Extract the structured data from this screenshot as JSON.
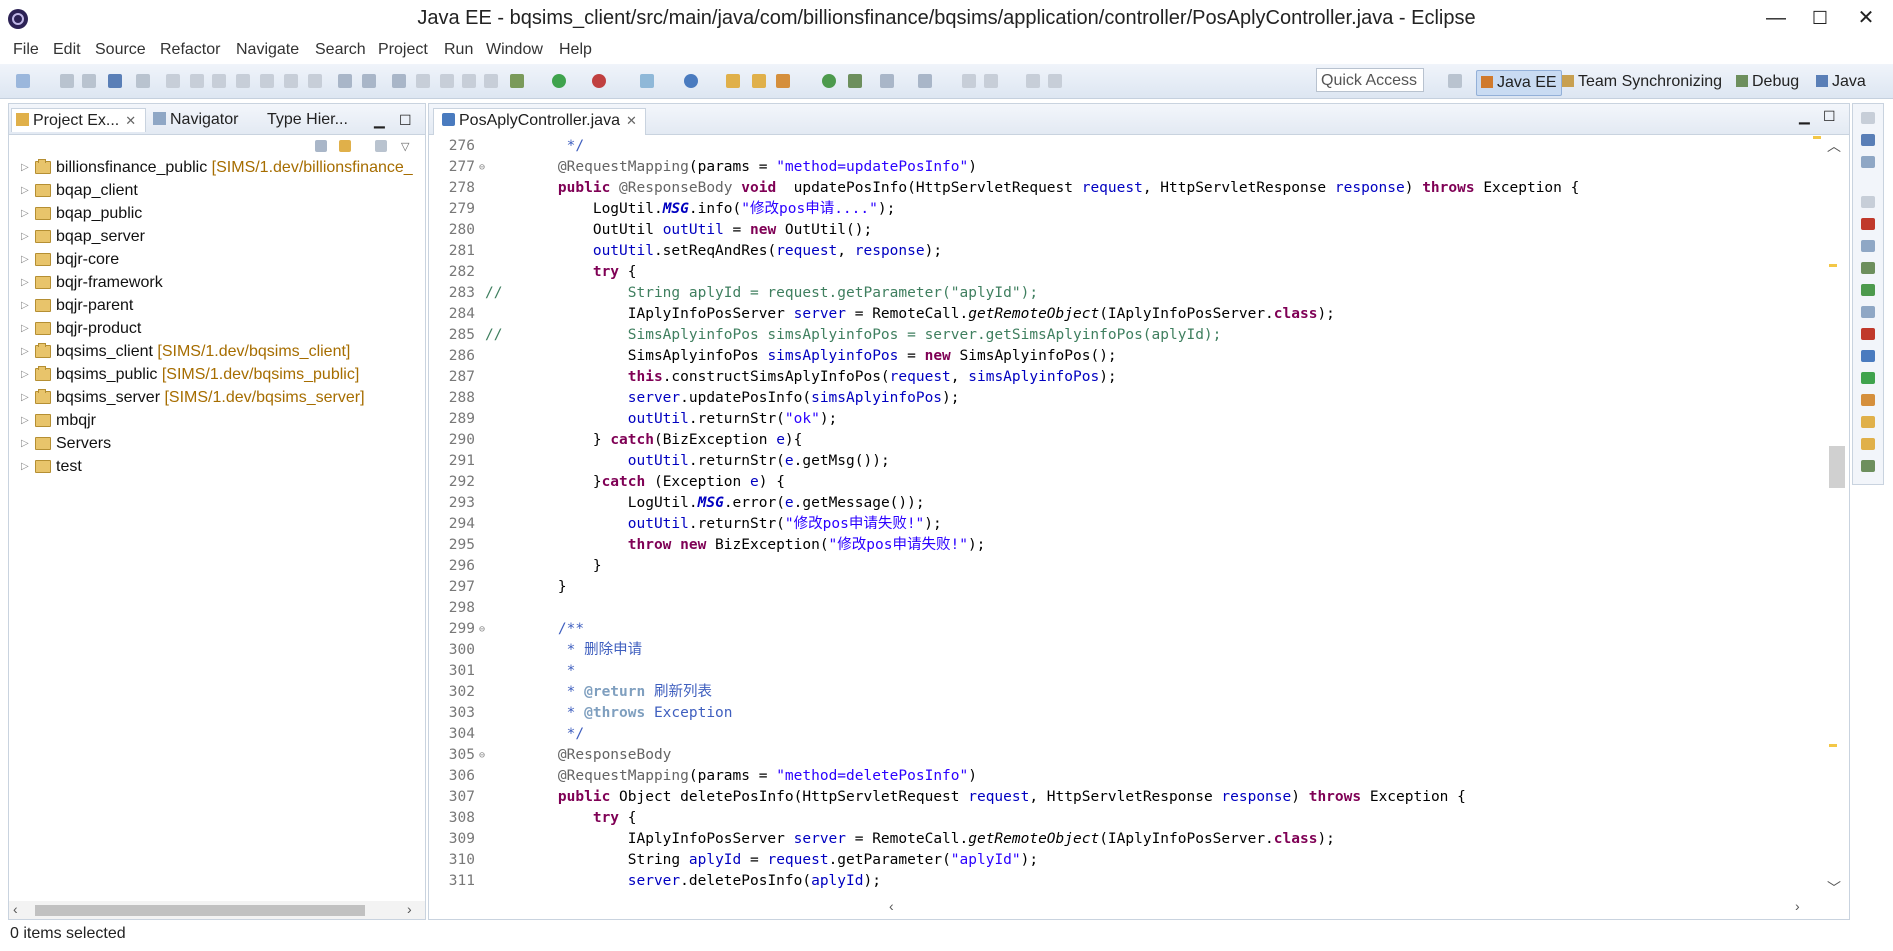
{
  "window": {
    "title": "Java EE - bqsims_client/src/main/java/com/billionsfinance/bqsims/application/controller/PosAplyController.java - Eclipse",
    "minimize": "—",
    "maximize": "☐",
    "close": "✕"
  },
  "menu": [
    "File",
    "Edit",
    "Source",
    "Refactor",
    "Navigate",
    "Search",
    "Project",
    "Run",
    "Window",
    "Help"
  ],
  "toolbar": {
    "quick_access_placeholder": "Quick Access",
    "perspectives": [
      "Java EE",
      "Team Synchronizing",
      "Debug",
      "Java"
    ]
  },
  "left_panel": {
    "tabs": [
      "Project Ex...",
      "Navigator",
      "Type Hier..."
    ],
    "tree": [
      {
        "name": "billionsfinance_public",
        "extra": "[SIMS/1.dev/billionsfinance_",
        "kind": "project"
      },
      {
        "name": "bqap_client",
        "extra": "",
        "kind": "folder"
      },
      {
        "name": "bqap_public",
        "extra": "",
        "kind": "folder"
      },
      {
        "name": "bqap_server",
        "extra": "",
        "kind": "folder"
      },
      {
        "name": "bqjr-core",
        "extra": "",
        "kind": "folder"
      },
      {
        "name": "bqjr-framework",
        "extra": "",
        "kind": "folder"
      },
      {
        "name": "bqjr-parent",
        "extra": "",
        "kind": "folder"
      },
      {
        "name": "bqjr-product",
        "extra": "",
        "kind": "folder"
      },
      {
        "name": "bqsims_client",
        "extra": "[SIMS/1.dev/bqsims_client]",
        "kind": "project"
      },
      {
        "name": "bqsims_public",
        "extra": "[SIMS/1.dev/bqsims_public]",
        "kind": "project"
      },
      {
        "name": "bqsims_server",
        "extra": "[SIMS/1.dev/bqsims_server]",
        "kind": "project"
      },
      {
        "name": "mbqjr",
        "extra": "",
        "kind": "folder"
      },
      {
        "name": "Servers",
        "extra": "",
        "kind": "folder"
      },
      {
        "name": "test",
        "extra": "",
        "kind": "folder"
      }
    ]
  },
  "editor": {
    "tab": "PosAplyController.java",
    "lines": [
      {
        "n": "276",
        "fold": false,
        "cm": false,
        "i": 0,
        "parts": [
          [
            "dc",
            "     */"
          ]
        ]
      },
      {
        "n": "277",
        "fold": true,
        "cm": false,
        "i": 0,
        "parts": [
          [
            "a",
            "    @RequestMapping"
          ],
          [
            "",
            "(params = "
          ],
          [
            "s",
            "\"method=updatePosInfo\""
          ],
          [
            "",
            ")"
          ]
        ]
      },
      {
        "n": "278",
        "fold": false,
        "cm": false,
        "i": 0,
        "parts": [
          [
            "k",
            "    public "
          ],
          [
            "a",
            "@ResponseBody "
          ],
          [
            "k",
            "void"
          ],
          [
            "",
            "  updatePosInfo(HttpServletRequest "
          ],
          [
            "v",
            "request"
          ],
          [
            "",
            ", HttpServletResponse "
          ],
          [
            "v",
            "response"
          ],
          [
            "",
            ") "
          ],
          [
            "k",
            "throws"
          ],
          [
            "",
            " Exception {"
          ]
        ]
      },
      {
        "n": "279",
        "fold": false,
        "cm": false,
        "i": 0,
        "parts": [
          [
            "",
            "        LogUtil."
          ],
          [
            "f",
            "MSG"
          ],
          [
            "",
            ".info("
          ],
          [
            "s",
            "\"修改pos申请....\""
          ],
          [
            "",
            ");"
          ]
        ]
      },
      {
        "n": "280",
        "fold": false,
        "cm": false,
        "i": 0,
        "parts": [
          [
            "",
            "        OutUtil "
          ],
          [
            "v",
            "outUtil"
          ],
          [
            "",
            " = "
          ],
          [
            "k",
            "new"
          ],
          [
            "",
            " OutUtil();"
          ]
        ]
      },
      {
        "n": "281",
        "fold": false,
        "cm": false,
        "i": 0,
        "parts": [
          [
            "v",
            "        outUtil"
          ],
          [
            "",
            ".setReqAndRes("
          ],
          [
            "v",
            "request"
          ],
          [
            "",
            ", "
          ],
          [
            "v",
            "response"
          ],
          [
            "",
            ");"
          ]
        ]
      },
      {
        "n": "282",
        "fold": false,
        "cm": false,
        "i": 0,
        "parts": [
          [
            "k",
            "        try"
          ],
          [
            "",
            " {"
          ]
        ]
      },
      {
        "n": "283",
        "fold": false,
        "cm": true,
        "i": 0,
        "parts": [
          [
            "cmt",
            "            String aplyId = request.getParameter(\"aplyId\");"
          ]
        ]
      },
      {
        "n": "284",
        "fold": false,
        "cm": false,
        "i": 0,
        "parts": [
          [
            "",
            "            IAplyInfoPosServer "
          ],
          [
            "v",
            "server"
          ],
          [
            "",
            " = RemoteCall."
          ],
          [
            "st",
            "getRemoteObject"
          ],
          [
            "",
            "(IAplyInfoPosServer."
          ],
          [
            "k",
            "class"
          ],
          [
            "",
            ");"
          ]
        ]
      },
      {
        "n": "285",
        "fold": false,
        "cm": true,
        "i": 0,
        "parts": [
          [
            "cmt",
            "            SimsAplyinfoPos simsAplyinfoPos = server.getSimsAplyinfoPos(aplyId);"
          ]
        ]
      },
      {
        "n": "286",
        "fold": false,
        "cm": false,
        "i": 0,
        "parts": [
          [
            "",
            "            SimsAplyinfoPos "
          ],
          [
            "v",
            "simsAplyinfoPos"
          ],
          [
            "",
            " = "
          ],
          [
            "k",
            "new"
          ],
          [
            "",
            " SimsAplyinfoPos();"
          ]
        ]
      },
      {
        "n": "287",
        "fold": false,
        "cm": false,
        "i": 0,
        "parts": [
          [
            "k",
            "            this"
          ],
          [
            "",
            ".constructSimsAplyInfoPos("
          ],
          [
            "v",
            "request"
          ],
          [
            "",
            ", "
          ],
          [
            "v",
            "simsAplyinfoPos"
          ],
          [
            "",
            ");"
          ]
        ]
      },
      {
        "n": "288",
        "fold": false,
        "cm": false,
        "i": 0,
        "parts": [
          [
            "v",
            "            server"
          ],
          [
            "",
            ".updatePosInfo("
          ],
          [
            "v",
            "simsAplyinfoPos"
          ],
          [
            "",
            ");"
          ]
        ]
      },
      {
        "n": "289",
        "fold": false,
        "cm": false,
        "i": 0,
        "parts": [
          [
            "v",
            "            outUtil"
          ],
          [
            "",
            ".returnStr("
          ],
          [
            "s",
            "\"ok\""
          ],
          [
            "",
            ");"
          ]
        ]
      },
      {
        "n": "290",
        "fold": false,
        "cm": false,
        "i": 0,
        "parts": [
          [
            "",
            "        } "
          ],
          [
            "k",
            "catch"
          ],
          [
            "",
            "(BizException "
          ],
          [
            "v",
            "e"
          ],
          [
            "",
            "){"
          ]
        ]
      },
      {
        "n": "291",
        "fold": false,
        "cm": false,
        "i": 0,
        "parts": [
          [
            "v",
            "            outUtil"
          ],
          [
            "",
            ".returnStr("
          ],
          [
            "v",
            "e"
          ],
          [
            "",
            ".getMsg());"
          ]
        ]
      },
      {
        "n": "292",
        "fold": false,
        "cm": false,
        "i": 0,
        "parts": [
          [
            "",
            "        }"
          ],
          [
            "k",
            "catch"
          ],
          [
            "",
            " (Exception "
          ],
          [
            "v",
            "e"
          ],
          [
            "",
            ") {"
          ]
        ]
      },
      {
        "n": "293",
        "fold": false,
        "cm": false,
        "i": 0,
        "parts": [
          [
            "",
            "            LogUtil."
          ],
          [
            "f",
            "MSG"
          ],
          [
            "",
            ".error("
          ],
          [
            "v",
            "e"
          ],
          [
            "",
            ".getMessage());"
          ]
        ]
      },
      {
        "n": "294",
        "fold": false,
        "cm": false,
        "i": 0,
        "parts": [
          [
            "v",
            "            outUtil"
          ],
          [
            "",
            ".returnStr("
          ],
          [
            "s",
            "\"修改pos申请失败!\""
          ],
          [
            "",
            ");"
          ]
        ]
      },
      {
        "n": "295",
        "fold": false,
        "cm": false,
        "i": 0,
        "parts": [
          [
            "k",
            "            throw new"
          ],
          [
            "",
            " BizException("
          ],
          [
            "s",
            "\"修改pos申请失败!\""
          ],
          [
            "",
            ");"
          ]
        ]
      },
      {
        "n": "296",
        "fold": false,
        "cm": false,
        "i": 0,
        "parts": [
          [
            "",
            "        }"
          ]
        ]
      },
      {
        "n": "297",
        "fold": false,
        "cm": false,
        "i": 0,
        "parts": [
          [
            "",
            "    }"
          ]
        ]
      },
      {
        "n": "298",
        "fold": false,
        "cm": false,
        "i": 0,
        "parts": [
          [
            "",
            ""
          ]
        ]
      },
      {
        "n": "299",
        "fold": true,
        "cm": false,
        "i": 0,
        "parts": [
          [
            "dc",
            "    /**"
          ]
        ]
      },
      {
        "n": "300",
        "fold": false,
        "cm": false,
        "i": 0,
        "parts": [
          [
            "dc",
            "     * 删除申请"
          ]
        ]
      },
      {
        "n": "301",
        "fold": false,
        "cm": false,
        "i": 0,
        "parts": [
          [
            "dc",
            "     *"
          ]
        ]
      },
      {
        "n": "302",
        "fold": false,
        "cm": false,
        "i": 0,
        "parts": [
          [
            "dc",
            "     * "
          ],
          [
            "dk",
            "@return"
          ],
          [
            "dc",
            " 刷新列表"
          ]
        ]
      },
      {
        "n": "303",
        "fold": false,
        "cm": false,
        "i": 0,
        "parts": [
          [
            "dc",
            "     * "
          ],
          [
            "dk",
            "@throws"
          ],
          [
            "dc",
            " Exception"
          ]
        ]
      },
      {
        "n": "304",
        "fold": false,
        "cm": false,
        "i": 0,
        "parts": [
          [
            "dc",
            "     */"
          ]
        ]
      },
      {
        "n": "305",
        "fold": true,
        "cm": false,
        "i": 0,
        "parts": [
          [
            "a",
            "    @ResponseBody"
          ]
        ]
      },
      {
        "n": "306",
        "fold": false,
        "cm": false,
        "i": 0,
        "parts": [
          [
            "a",
            "    @RequestMapping"
          ],
          [
            "",
            "(params = "
          ],
          [
            "s",
            "\"method=deletePosInfo\""
          ],
          [
            "",
            ")"
          ]
        ]
      },
      {
        "n": "307",
        "fold": false,
        "cm": false,
        "i": 0,
        "parts": [
          [
            "k",
            "    public"
          ],
          [
            "",
            " Object deletePosInfo(HttpServletRequest "
          ],
          [
            "v",
            "request"
          ],
          [
            "",
            ", HttpServletResponse "
          ],
          [
            "v",
            "response"
          ],
          [
            "",
            ") "
          ],
          [
            "k",
            "throws"
          ],
          [
            "",
            " Exception {"
          ]
        ]
      },
      {
        "n": "308",
        "fold": false,
        "cm": false,
        "i": 0,
        "parts": [
          [
            "k",
            "        try"
          ],
          [
            "",
            " {"
          ]
        ]
      },
      {
        "n": "309",
        "fold": false,
        "cm": false,
        "i": 0,
        "parts": [
          [
            "",
            "            IAplyInfoPosServer "
          ],
          [
            "v",
            "server"
          ],
          [
            "",
            " = RemoteCall."
          ],
          [
            "st",
            "getRemoteObject"
          ],
          [
            "",
            "(IAplyInfoPosServer."
          ],
          [
            "k",
            "class"
          ],
          [
            "",
            ");"
          ]
        ]
      },
      {
        "n": "310",
        "fold": false,
        "cm": false,
        "i": 0,
        "parts": [
          [
            "",
            "            String "
          ],
          [
            "v",
            "aplyId"
          ],
          [
            "",
            " = "
          ],
          [
            "v",
            "request"
          ],
          [
            "",
            ".getParameter("
          ],
          [
            "s",
            "\"aplyId\""
          ],
          [
            "",
            ");"
          ]
        ]
      },
      {
        "n": "311",
        "fold": false,
        "cm": false,
        "i": 0,
        "parts": [
          [
            "v",
            "            server"
          ],
          [
            "",
            ".deletePosInfo("
          ],
          [
            "v",
            "aplyId"
          ],
          [
            "",
            ");"
          ]
        ]
      }
    ]
  },
  "status": {
    "text": "0 items selected"
  }
}
